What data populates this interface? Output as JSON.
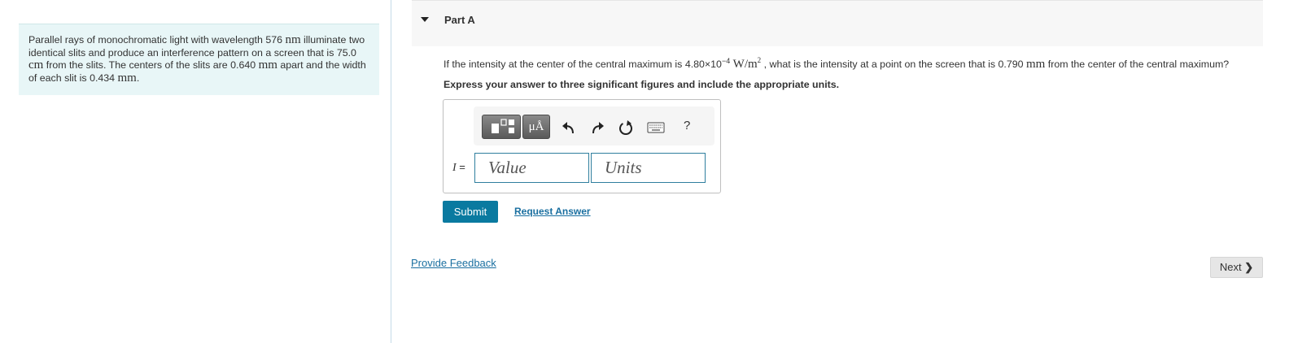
{
  "problem": {
    "seg1": "Parallel rays of monochromatic light with wavelength 576 ",
    "unit_nm": "nm",
    "seg2": " illuminate two identical slits and produce an interference pattern on a screen that is 75.0 ",
    "unit_cm": "cm",
    "seg3": " from the slits. The centers of the slits are 0.640 ",
    "unit_mm_1": "mm",
    "seg4": " apart and the width of each slit is 0.434 ",
    "unit_mm_2": "mm",
    "seg5": "."
  },
  "part": {
    "title": "Part A"
  },
  "question": {
    "seg1": "If the intensity at the center of the central maximum is 4.80×10",
    "exp": "−4",
    "unit_w": "W/m",
    "unit_exp": "2",
    "seg2": " , what is the intensity at a point on the screen that is 0.790 ",
    "unit_mm": "mm",
    "seg3": " from the center of the central maximum?"
  },
  "instruction": "Express your answer to three significant figures and include the appropriate units.",
  "toolbar": {
    "units_label": "μÅ",
    "help_label": "?",
    "icons": [
      "templates-icon",
      "undo-icon",
      "redo-icon",
      "reset-icon",
      "keyboard-icon",
      "help-icon"
    ]
  },
  "answer": {
    "variable": "I",
    "equals": " =",
    "value_placeholder": "Value",
    "units_placeholder": "Units"
  },
  "actions": {
    "submit_label": "Submit",
    "request_answer_label": "Request Answer"
  },
  "feedback_label": "Provide Feedback",
  "next_label": "Next",
  "colors": {
    "problem_bg": "#e8f6f7",
    "submit_bg": "#0a7aa0",
    "link": "#1a6fa0",
    "input_border": "#2f7f9e"
  }
}
